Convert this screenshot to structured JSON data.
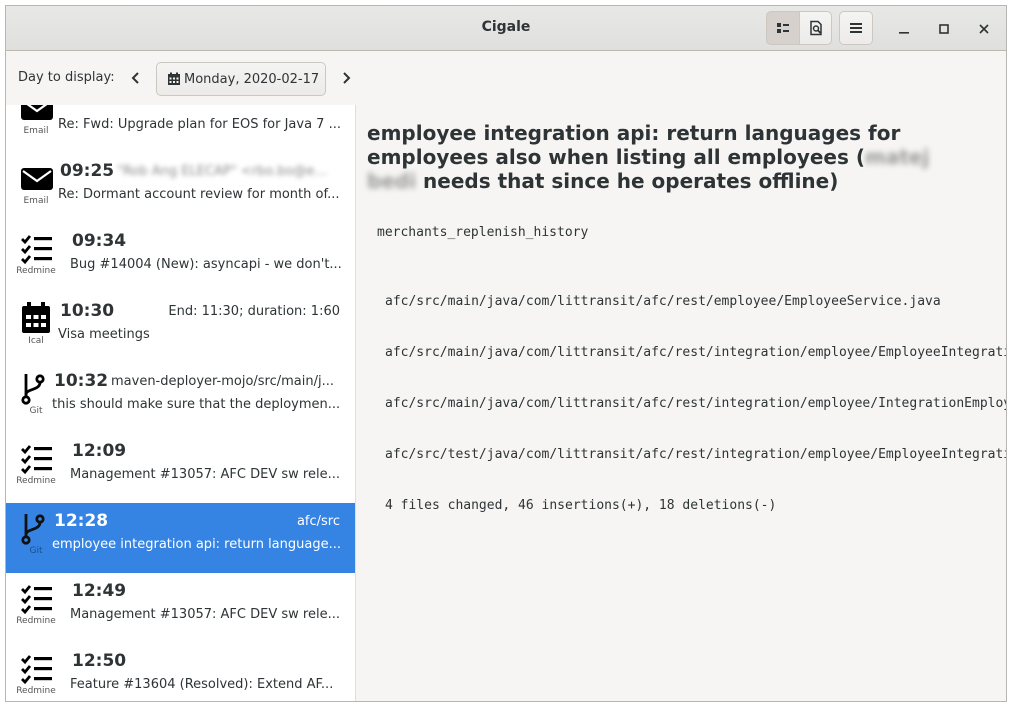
{
  "window": {
    "title": "Cigale"
  },
  "toolbar": {
    "day_label": "Day to display:",
    "date": "Monday, 2020-02-17"
  },
  "events": [
    {
      "source": "Email",
      "icon": "email",
      "time": "",
      "extra": "",
      "extra_blurred": false,
      "desc": "Re: Fwd: Upgrade plan for EOS for Java 7 ...",
      "selected": false
    },
    {
      "source": "Email",
      "icon": "email",
      "time": "09:25",
      "extra": "\"Rob Ang ELECAP\" <rbo.bo@email...",
      "extra_blurred": true,
      "desc": "Re: Dormant account review for month of...",
      "selected": false
    },
    {
      "source": "Redmine",
      "icon": "redmine",
      "time": "09:34",
      "extra": "",
      "extra_blurred": false,
      "desc": "Bug #14004 (New): asyncapi - we don't...",
      "selected": false
    },
    {
      "source": "Ical",
      "icon": "ical",
      "time": "10:30",
      "extra": "End: 11:30; duration: 1:60",
      "extra_blurred": false,
      "desc": "Visa meetings",
      "selected": false
    },
    {
      "source": "Git",
      "icon": "git",
      "time": "10:32",
      "extra": "maven-deployer-mojo/src/main/j...",
      "extra_blurred": false,
      "desc": "this should make sure that the deploymen...",
      "selected": false
    },
    {
      "source": "Redmine",
      "icon": "redmine",
      "time": "12:09",
      "extra": "",
      "extra_blurred": false,
      "desc": "Management #13057: AFC DEV sw rele...",
      "selected": false
    },
    {
      "source": "Git",
      "icon": "git",
      "time": "12:28",
      "extra": "afc/src",
      "extra_blurred": false,
      "desc": "employee integration api: return language...",
      "selected": true
    },
    {
      "source": "Redmine",
      "icon": "redmine",
      "time": "12:49",
      "extra": "",
      "extra_blurred": false,
      "desc": "Management #13057: AFC DEV sw rele...",
      "selected": false
    },
    {
      "source": "Redmine",
      "icon": "redmine",
      "time": "12:50",
      "extra": "",
      "extra_blurred": false,
      "desc": "Feature #13604 (Resolved): Extend AF...",
      "selected": false
    }
  ],
  "detail": {
    "title_part1": "employee integration api: return languages for employees also when listing all employees (",
    "title_blurred": "matej bedi",
    "title_part2": " needs that since he operates offline)",
    "branch": "merchants_replenish_history",
    "files": [
      "afc/src/main/java/com/littransit/afc/rest/employee/EmployeeService.java",
      "afc/src/main/java/com/littransit/afc/rest/integration/employee/EmployeeIntegrationService.java",
      "afc/src/main/java/com/littransit/afc/rest/integration/employee/IntegrationEmployee.java",
      "afc/src/test/java/com/littransit/afc/rest/integration/employee/EmployeeIntegrationServiceTest.java"
    ],
    "summary": "4 files changed, 46 insertions(+), 18 deletions(-)"
  }
}
